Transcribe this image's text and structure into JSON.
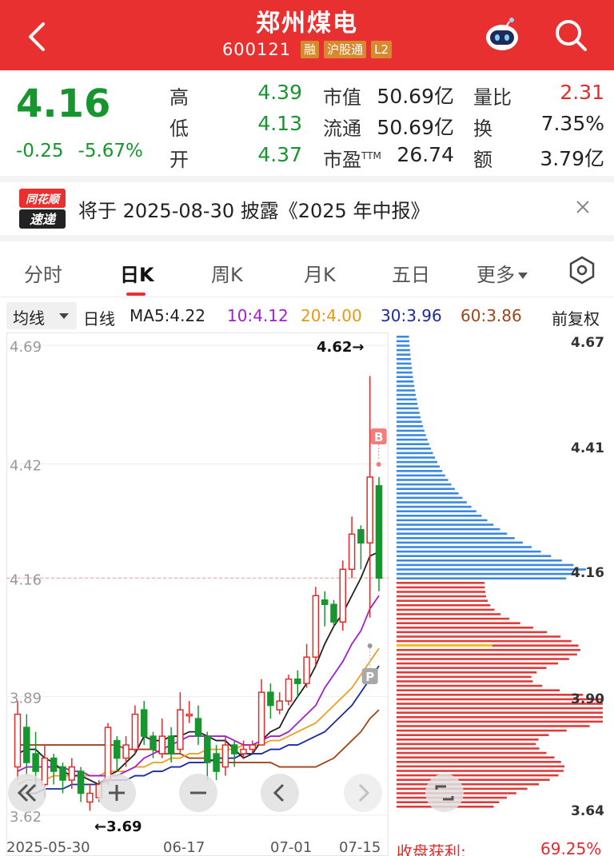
{
  "header": {
    "title": "郑州煤电",
    "code": "600121",
    "tags": [
      "融",
      "沪股通",
      "L2"
    ]
  },
  "quote": {
    "price": "4.16",
    "change": "-0.25",
    "change_pct": "-5.67%",
    "high_label": "高",
    "high": "4.39",
    "low_label": "低",
    "low": "4.13",
    "open_label": "开",
    "open": "4.37",
    "mcap_label": "市值",
    "mcap": "50.69亿",
    "float_label": "流通",
    "float": "50.69亿",
    "pe_label": "市盈",
    "pe_sup": "TTM",
    "pe": "26.74",
    "volratio_label": "量比",
    "volratio": "2.31",
    "turnover_label": "换",
    "turnover": "7.35%",
    "amount_label": "额",
    "amount": "3.79亿"
  },
  "news": {
    "logo_line1": "同花顺",
    "logo_line2": "速递",
    "text": "将于 2025-08-30 披露《2025 年中报》"
  },
  "tabs": {
    "fenshi": "分时",
    "rik": "日K",
    "zhouk": "周K",
    "yuek": "月K",
    "wuri": "五日",
    "more": "更多"
  },
  "ma": {
    "selector": "均线",
    "period": "日线",
    "ma5": "MA5:4.22",
    "ma10": "10:4.12",
    "ma20": "20:4.00",
    "ma30": "30:3.96",
    "ma60": "60:3.86",
    "adjust": "前复权"
  },
  "colors": {
    "up": "#e32a2a",
    "down": "#17962f",
    "ma5": "#222222",
    "ma10": "#a020d0",
    "ma20": "#f0a020",
    "ma30": "#1a2aa0",
    "ma60": "#a0441a",
    "profile_up": "#3a88e0",
    "profile_down": "#e03a3a"
  },
  "chart_data": {
    "type": "candlestick",
    "y_ticks": [
      "4.69",
      "4.42",
      "4.16",
      "3.89",
      "3.62"
    ],
    "x_ticks": [
      "2025-05-30",
      "06-17",
      "07-01",
      "07-15"
    ],
    "current_price_line": 4.16,
    "high_marker": "4.62→",
    "low_marker": "←3.69",
    "buy_marker": "B",
    "p_marker": "P",
    "candles": [
      {
        "o": 3.73,
        "c": 3.85,
        "h": 3.88,
        "l": 3.7
      },
      {
        "o": 3.82,
        "c": 3.74,
        "h": 3.85,
        "l": 3.71
      },
      {
        "o": 3.76,
        "c": 3.72,
        "h": 3.81,
        "l": 3.68
      },
      {
        "o": 3.69,
        "c": 3.75,
        "h": 3.78,
        "l": 3.66
      },
      {
        "o": 3.75,
        "c": 3.72,
        "h": 3.76,
        "l": 3.69
      },
      {
        "o": 3.73,
        "c": 3.7,
        "h": 3.74,
        "l": 3.67
      },
      {
        "o": 3.7,
        "c": 3.73,
        "h": 3.75,
        "l": 3.68
      },
      {
        "o": 3.72,
        "c": 3.67,
        "h": 3.73,
        "l": 3.65
      },
      {
        "o": 3.65,
        "c": 3.67,
        "h": 3.69,
        "l": 3.63
      },
      {
        "o": 3.66,
        "c": 3.69,
        "h": 3.7,
        "l": 3.65
      },
      {
        "o": 3.7,
        "c": 3.82,
        "h": 3.83,
        "l": 3.69
      },
      {
        "o": 3.79,
        "c": 3.75,
        "h": 3.8,
        "l": 3.72
      },
      {
        "o": 3.75,
        "c": 3.78,
        "h": 3.8,
        "l": 3.73
      },
      {
        "o": 3.77,
        "c": 3.85,
        "h": 3.87,
        "l": 3.76
      },
      {
        "o": 3.86,
        "c": 3.8,
        "h": 3.88,
        "l": 3.78
      },
      {
        "o": 3.8,
        "c": 3.77,
        "h": 3.81,
        "l": 3.75
      },
      {
        "o": 3.76,
        "c": 3.8,
        "h": 3.84,
        "l": 3.75
      },
      {
        "o": 3.8,
        "c": 3.76,
        "h": 3.82,
        "l": 3.74
      },
      {
        "o": 3.77,
        "c": 3.86,
        "h": 3.9,
        "l": 3.76
      },
      {
        "o": 3.85,
        "c": 3.85,
        "h": 3.88,
        "l": 3.83
      },
      {
        "o": 3.84,
        "c": 3.8,
        "h": 3.87,
        "l": 3.78
      },
      {
        "o": 3.8,
        "c": 3.74,
        "h": 3.81,
        "l": 3.7
      },
      {
        "o": 3.76,
        "c": 3.72,
        "h": 3.78,
        "l": 3.7
      },
      {
        "o": 3.73,
        "c": 3.78,
        "h": 3.8,
        "l": 3.71
      },
      {
        "o": 3.78,
        "c": 3.76,
        "h": 3.79,
        "l": 3.73
      },
      {
        "o": 3.76,
        "c": 3.77,
        "h": 3.79,
        "l": 3.75
      },
      {
        "o": 3.77,
        "c": 3.78,
        "h": 3.79,
        "l": 3.76
      },
      {
        "o": 3.78,
        "c": 3.9,
        "h": 3.93,
        "l": 3.78
      },
      {
        "o": 3.9,
        "c": 3.87,
        "h": 3.92,
        "l": 3.84
      },
      {
        "o": 3.86,
        "c": 3.88,
        "h": 3.9,
        "l": 3.85
      },
      {
        "o": 3.88,
        "c": 3.93,
        "h": 3.94,
        "l": 3.87
      },
      {
        "o": 3.93,
        "c": 3.92,
        "h": 3.95,
        "l": 3.89
      },
      {
        "o": 3.92,
        "c": 3.98,
        "h": 4.01,
        "l": 3.91
      },
      {
        "o": 3.98,
        "c": 4.12,
        "h": 4.14,
        "l": 3.96
      },
      {
        "o": 4.11,
        "c": 4.1,
        "h": 4.13,
        "l": 4.05
      },
      {
        "o": 4.1,
        "c": 4.06,
        "h": 4.11,
        "l": 4.05
      },
      {
        "o": 4.06,
        "c": 4.18,
        "h": 4.2,
        "l": 4.04
      },
      {
        "o": 4.18,
        "c": 4.26,
        "h": 4.3,
        "l": 4.16
      },
      {
        "o": 4.27,
        "c": 4.24,
        "h": 4.28,
        "l": 4.18
      },
      {
        "o": 4.24,
        "c": 4.39,
        "h": 4.62,
        "l": 4.07
      },
      {
        "o": 4.37,
        "c": 4.16,
        "h": 4.39,
        "l": 4.13
      }
    ],
    "ma5_line": [
      3.76,
      3.77,
      3.77,
      3.75,
      3.74,
      3.72,
      3.71,
      3.71,
      3.7,
      3.69,
      3.71,
      3.72,
      3.74,
      3.76,
      3.8,
      3.79,
      3.79,
      3.8,
      3.8,
      3.81,
      3.81,
      3.8,
      3.79,
      3.79,
      3.77,
      3.75,
      3.76,
      3.79,
      3.81,
      3.82,
      3.86,
      3.89,
      3.92,
      3.96,
      4.01,
      4.05,
      4.08,
      4.12,
      4.16,
      4.21,
      4.22
    ],
    "ma10_line": [
      3.72,
      3.73,
      3.73,
      3.73,
      3.73,
      3.73,
      3.72,
      3.72,
      3.71,
      3.71,
      3.71,
      3.71,
      3.72,
      3.73,
      3.75,
      3.76,
      3.77,
      3.78,
      3.79,
      3.8,
      3.8,
      3.8,
      3.8,
      3.8,
      3.79,
      3.78,
      3.78,
      3.79,
      3.8,
      3.8,
      3.81,
      3.83,
      3.85,
      3.87,
      3.91,
      3.94,
      3.97,
      4.01,
      4.04,
      4.09,
      4.12
    ],
    "ma20_line": [
      3.69,
      3.7,
      3.7,
      3.7,
      3.71,
      3.71,
      3.71,
      3.71,
      3.71,
      3.71,
      3.72,
      3.72,
      3.72,
      3.73,
      3.73,
      3.74,
      3.74,
      3.75,
      3.75,
      3.76,
      3.76,
      3.77,
      3.77,
      3.77,
      3.77,
      3.78,
      3.78,
      3.78,
      3.79,
      3.79,
      3.8,
      3.81,
      3.82,
      3.83,
      3.85,
      3.87,
      3.89,
      3.91,
      3.94,
      3.97,
      4.0
    ],
    "ma30_line": [
      3.67,
      3.67,
      3.67,
      3.68,
      3.68,
      3.68,
      3.69,
      3.69,
      3.69,
      3.69,
      3.7,
      3.7,
      3.7,
      3.71,
      3.71,
      3.72,
      3.72,
      3.73,
      3.73,
      3.74,
      3.74,
      3.74,
      3.75,
      3.75,
      3.75,
      3.76,
      3.76,
      3.76,
      3.77,
      3.77,
      3.78,
      3.78,
      3.79,
      3.8,
      3.81,
      3.83,
      3.85,
      3.87,
      3.9,
      3.93,
      3.96
    ],
    "ma60_line": [
      3.78,
      3.78,
      3.78,
      3.78,
      3.78,
      3.78,
      3.78,
      3.78,
      3.78,
      3.78,
      3.78,
      3.78,
      3.77,
      3.77,
      3.77,
      3.77,
      3.76,
      3.76,
      3.76,
      3.75,
      3.75,
      3.75,
      3.74,
      3.74,
      3.74,
      3.74,
      3.74,
      3.74,
      3.74,
      3.73,
      3.73,
      3.73,
      3.73,
      3.73,
      3.74,
      3.75,
      3.77,
      3.79,
      3.81,
      3.84,
      3.86
    ]
  },
  "profile": {
    "labels": [
      "4.67",
      "4.41",
      "4.16",
      "3.90",
      "3.64"
    ],
    "profit_label": "收盘获利:",
    "profit_value": "69.25%"
  }
}
